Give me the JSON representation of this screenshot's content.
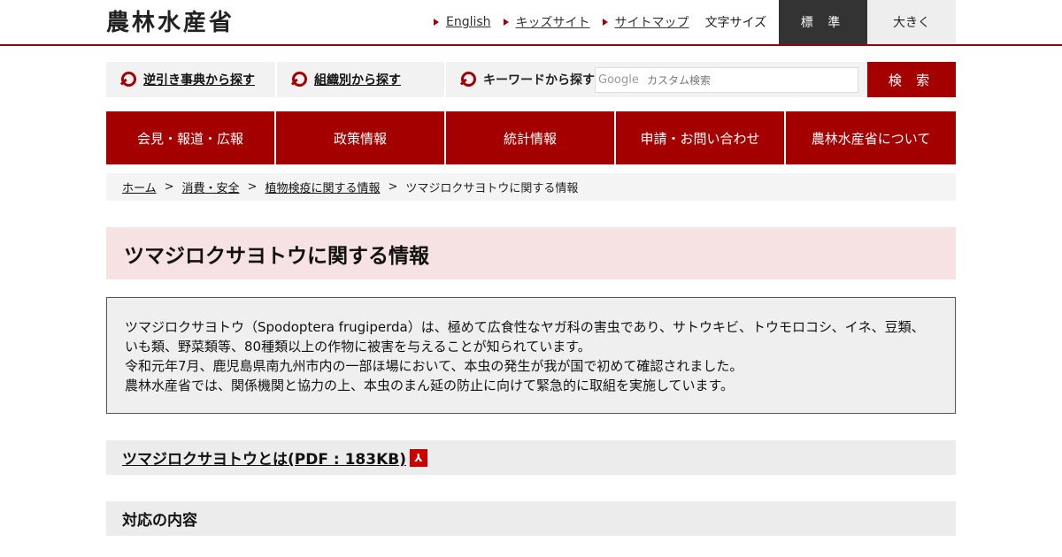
{
  "header": {
    "logo": "農林水産省",
    "links": [
      "English",
      "キッズサイト",
      "サイトマップ"
    ],
    "fontsize_label": "文字サイズ",
    "fontsize_standard": "標 準",
    "fontsize_large": "大きく"
  },
  "search": {
    "reverse_dict": "逆引き事典から探す",
    "by_org": "組織別から探す",
    "keyword_label": "キーワードから探す",
    "google_mark": "Google",
    "placeholder": "カスタム検索",
    "button": "検 索"
  },
  "gnav": [
    {
      "label": "会見・報道・広報"
    },
    {
      "label": "政策情報"
    },
    {
      "label": "統計情報"
    },
    {
      "label": "申請・お問い合わせ"
    },
    {
      "label": "農林水産省について"
    }
  ],
  "breadcrumb": {
    "home": "ホーム",
    "level1": "消費・安全",
    "level2": "植物検疫に関する情報",
    "current": "ツマジロクサヨトウに関する情報",
    "sep": ">"
  },
  "page_title": "ツマジロクサヨトウに関する情報",
  "intro": {
    "p1": "ツマジロクサヨトウ（Spodoptera frugiperda）は、極めて広食性なヤガ科の害虫であり、サトウキビ、トウモロコシ、イネ、豆類、いも類、野菜類等、80種類以上の作物に被害を与えることが知られています。",
    "p2": "令和元年7月、鹿児島県南九州市内の一部ほ場において、本虫の発生が我が国で初めて確認されました。",
    "p3": "農林水産省では、関係機関と協力の上、本虫のまん延の防止に向けて緊急的に取組を実施しています。"
  },
  "sections": {
    "pdf_link": "ツマジロクサヨトウとは(PDF : 183KB)",
    "response": "対応の内容"
  },
  "colors": {
    "brand": "#a40000",
    "title_bg": "#f6e2e2"
  }
}
